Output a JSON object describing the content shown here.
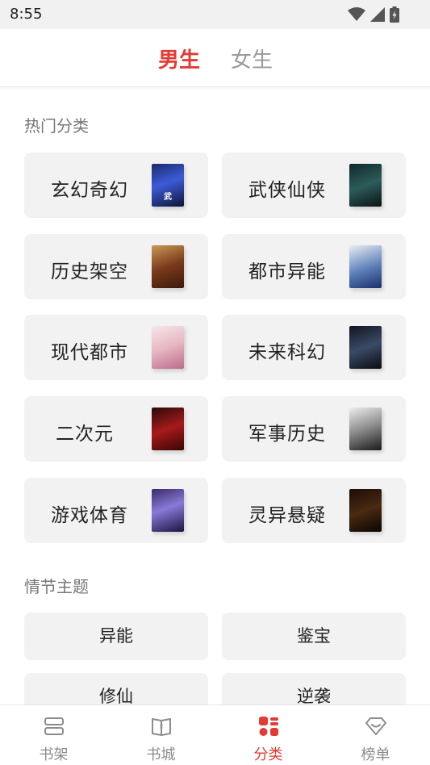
{
  "status_bar": {
    "time": "8:55",
    "icons": [
      "wifi-icon",
      "signal-icon",
      "battery-icon"
    ]
  },
  "gender_tabs": {
    "male": "男生",
    "female": "女生",
    "active": "male"
  },
  "hot_categories": {
    "title": "热门分类",
    "items": [
      {
        "label": "玄幻奇幻",
        "cover_text": "武"
      },
      {
        "label": "武侠仙侠",
        "cover_text": ""
      },
      {
        "label": "历史架空",
        "cover_text": ""
      },
      {
        "label": "都市异能",
        "cover_text": ""
      },
      {
        "label": "现代都市",
        "cover_text": ""
      },
      {
        "label": "未来科幻",
        "cover_text": ""
      },
      {
        "label": "二次元",
        "cover_text": ""
      },
      {
        "label": "军事历史",
        "cover_text": ""
      },
      {
        "label": "游戏体育",
        "cover_text": ""
      },
      {
        "label": "灵异悬疑",
        "cover_text": ""
      }
    ]
  },
  "plot_themes": {
    "title": "情节主题",
    "items": [
      {
        "label": "异能"
      },
      {
        "label": "鉴宝"
      },
      {
        "label": "修仙"
      },
      {
        "label": "逆袭"
      }
    ]
  },
  "bottom_nav": {
    "items": [
      {
        "label": "书架"
      },
      {
        "label": "书城"
      },
      {
        "label": "分类"
      },
      {
        "label": "榜单"
      }
    ],
    "active_index": 2
  },
  "colors": {
    "accent": "#e23b33",
    "card_bg": "#f2f2f2",
    "inactive": "#8c8c8c"
  }
}
